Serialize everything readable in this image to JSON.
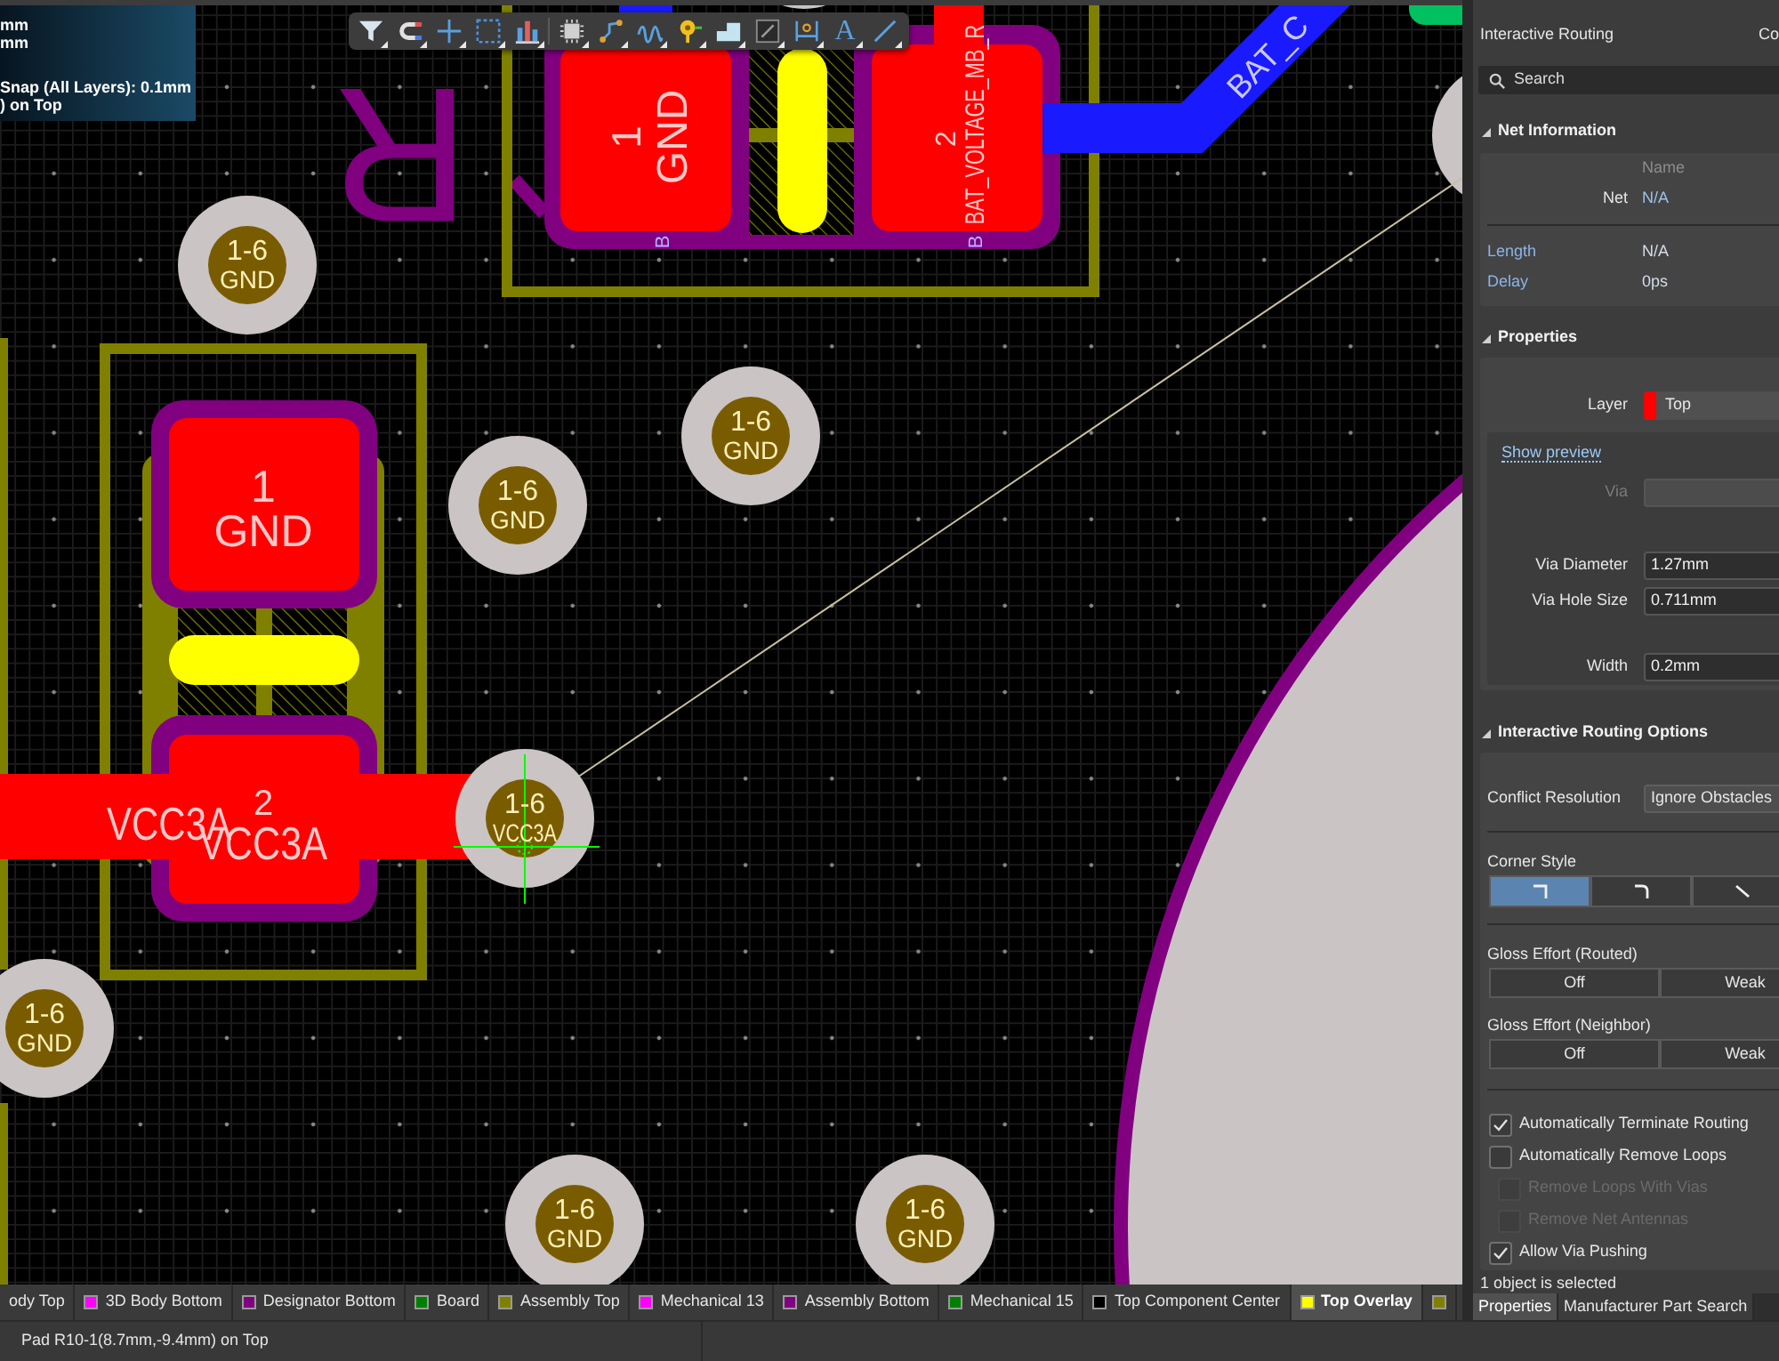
{
  "canvas": {
    "info_overlay": [
      [
        "mm",
        "mm"
      ],
      [
        "Snap (All Layers): 0.1mm",
        ") on Top"
      ]
    ],
    "toolbar": {
      "text_tool": "A"
    },
    "designator": "R",
    "overlay_marks": [
      "B",
      "B"
    ],
    "components": [
      {
        "pads": [
          {
            "number": "1",
            "net": "GND"
          },
          {
            "number": "2",
            "net": "BAT_VOLTAGE_MB_R"
          }
        ]
      },
      {
        "pads": [
          {
            "number": "1",
            "net": "GND"
          },
          {
            "number": "2",
            "net": "VCC3A"
          }
        ]
      }
    ],
    "traces": [
      {
        "label": "VCC3A"
      },
      {
        "label": "BAT_C"
      }
    ],
    "vias": [
      {
        "layers": "1-6",
        "net": "GND"
      },
      {
        "layers": "1-6",
        "net": "GND"
      },
      {
        "layers": "1-6",
        "net": "GND"
      },
      {
        "layers": "1-6",
        "net": "VCC3A"
      },
      {
        "layers": "1-6",
        "net": "GND"
      },
      {
        "layers": "1-6",
        "net": "GND"
      },
      {
        "layers": "1-6",
        "net": "GND"
      }
    ]
  },
  "layer_tabs": [
    {
      "label": "ody Top",
      "selected": false
    },
    {
      "label": "3D Body Bottom",
      "color": "#ff00ff",
      "selected": false
    },
    {
      "label": "Designator Bottom",
      "color": "#800080",
      "selected": false
    },
    {
      "label": "Board",
      "color": "#008000",
      "selected": false
    },
    {
      "label": "Assembly Top",
      "color": "#808000",
      "selected": false
    },
    {
      "label": "Mechanical 13",
      "color": "#ff00ff",
      "selected": false
    },
    {
      "label": "Assembly Bottom",
      "color": "#800080",
      "selected": false
    },
    {
      "label": "Mechanical 15",
      "color": "#008000",
      "selected": false
    },
    {
      "label": "Top Component Center",
      "color": "#000000",
      "selected": false
    },
    {
      "label": "Top Overlay",
      "color": "#ffff00",
      "selected": true
    },
    {
      "color": "#808000",
      "selected": false
    }
  ],
  "panel": {
    "title": "Interactive Routing",
    "tab_fragment": "Co",
    "search": {
      "placeholder": "Search"
    },
    "net_information": {
      "title": "Net Information",
      "expanded": true,
      "column_header": "Name",
      "net": {
        "label": "Net",
        "value": "N/A"
      },
      "rows": [
        {
          "label": "Length",
          "value": "N/A"
        },
        {
          "label": "Delay",
          "value": "0ps"
        }
      ]
    },
    "properties": {
      "title": "Properties",
      "expanded": true,
      "layer": {
        "label": "Layer",
        "value": "Top",
        "color": "#ff0000"
      },
      "preview_link": "Show preview",
      "via": {
        "label": "Via",
        "disabled": true
      },
      "via_fields": [
        {
          "label": "Via Diameter",
          "value": "1.27mm"
        },
        {
          "label": "Via Hole Size",
          "value": "0.711mm"
        }
      ],
      "width_field": {
        "label": "Width",
        "value": "0.2mm"
      }
    },
    "routing_options": {
      "title": "Interactive Routing Options",
      "expanded": true,
      "conflict_resolution": {
        "label": "Conflict Resolution",
        "value": "Ignore Obstacles"
      },
      "corner_style": {
        "label": "Corner Style",
        "options": [
          {
            "kind": "square",
            "selected": true
          },
          {
            "kind": "rounded",
            "selected": false
          },
          {
            "kind": "diagonal",
            "selected": false
          }
        ]
      },
      "gloss_effort": [
        {
          "label": "Gloss Effort (Routed)",
          "options": [
            {
              "label": "Off",
              "selected": false
            },
            {
              "label": "Weak",
              "selected": false
            }
          ]
        },
        {
          "label": "Gloss Effort (Neighbor)",
          "options": [
            {
              "label": "Off",
              "selected": false
            },
            {
              "label": "Weak",
              "selected": false
            }
          ]
        }
      ],
      "checkboxes": [
        {
          "label": "Automatically Terminate Routing",
          "checked": true,
          "disabled": false
        },
        {
          "label": "Automatically Remove Loops",
          "checked": false,
          "disabled": false,
          "children": [
            {
              "label": "Remove Loops With Vias",
              "checked": false,
              "disabled": true
            },
            {
              "label": "Remove Net Antennas",
              "checked": false,
              "disabled": true
            }
          ]
        },
        {
          "label": "Allow Via Pushing",
          "checked": true,
          "disabled": false
        }
      ]
    },
    "selection_status": "1 object is selected",
    "tabs": [
      {
        "label": "Properties",
        "selected": true
      },
      {
        "label": "Manufacturer Part Search",
        "selected": false
      }
    ]
  },
  "status_bar": {
    "text": "Pad R10-1(8.7mm,-9.4mm) on Top"
  }
}
